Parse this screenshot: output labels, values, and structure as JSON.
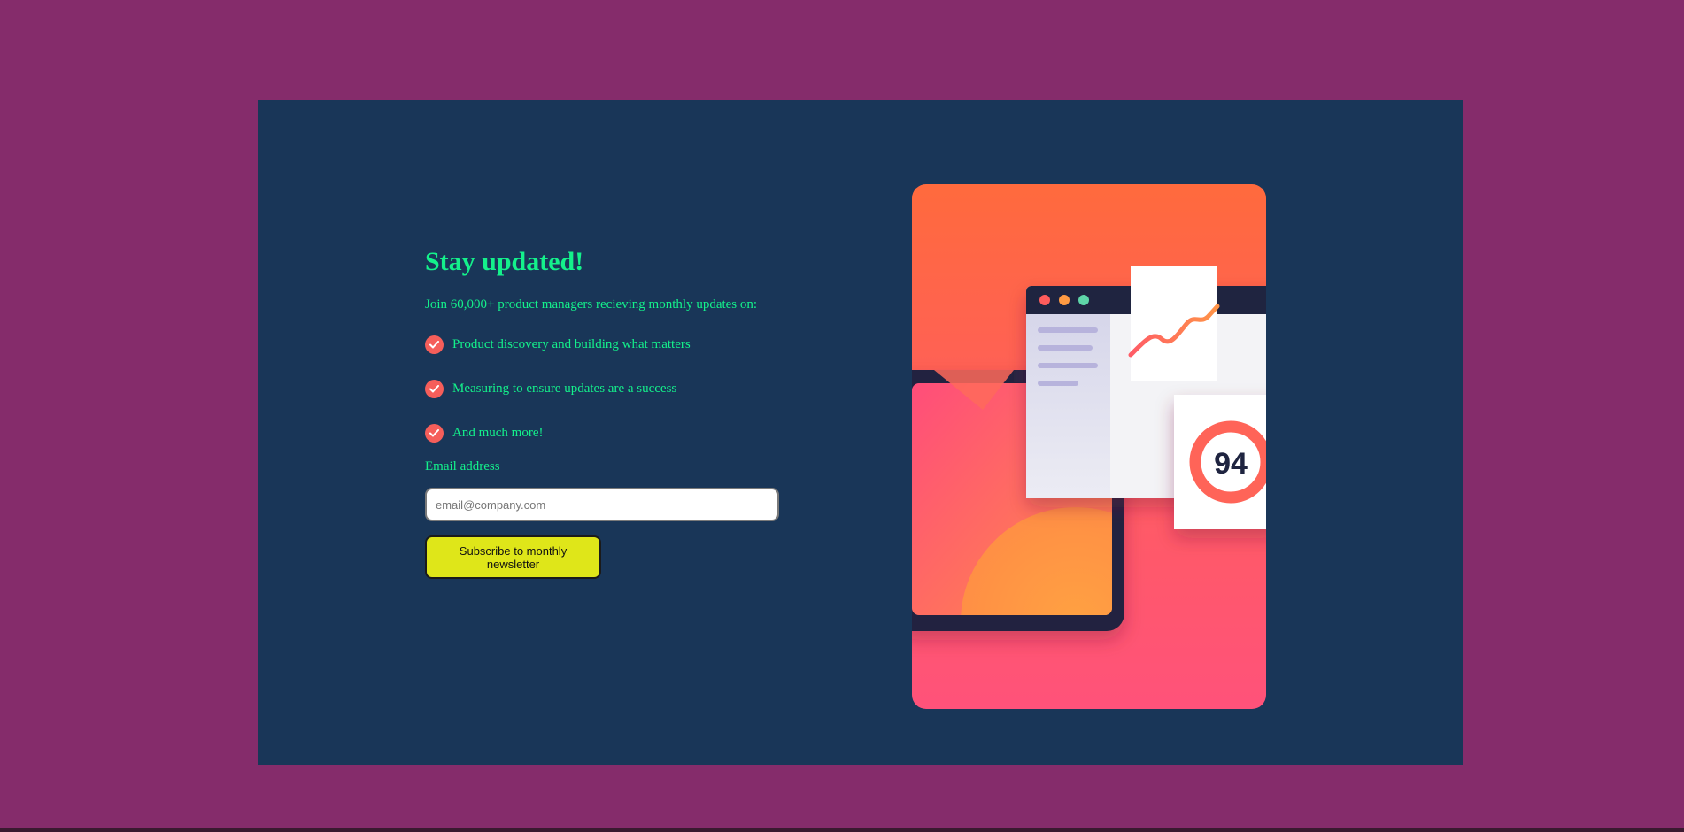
{
  "signup": {
    "title": "Stay updated!",
    "intro": "Join 60,000+ product managers recieving monthly updates on:",
    "features": [
      {
        "text": "Product discovery and building what matters",
        "icon": "check-icon"
      },
      {
        "text": "Measuring to ensure updates are a success",
        "icon": "check-icon"
      },
      {
        "text": "And much more!",
        "icon": "check-icon"
      }
    ],
    "email_label": "Email address",
    "email_placeholder": "email@company.com",
    "email_value": "",
    "subscribe_label": "Subscribe to monthly newsletter"
  },
  "illustration": {
    "score": "94"
  },
  "colors": {
    "page_background": "#852c6b",
    "card_background": "#193658",
    "text_accent": "#14f18b",
    "check_badge": "#f55e5a",
    "button_background": "#dfe619",
    "illustration_top": "#ff6a3d",
    "illustration_bottom": "#ff527a"
  }
}
